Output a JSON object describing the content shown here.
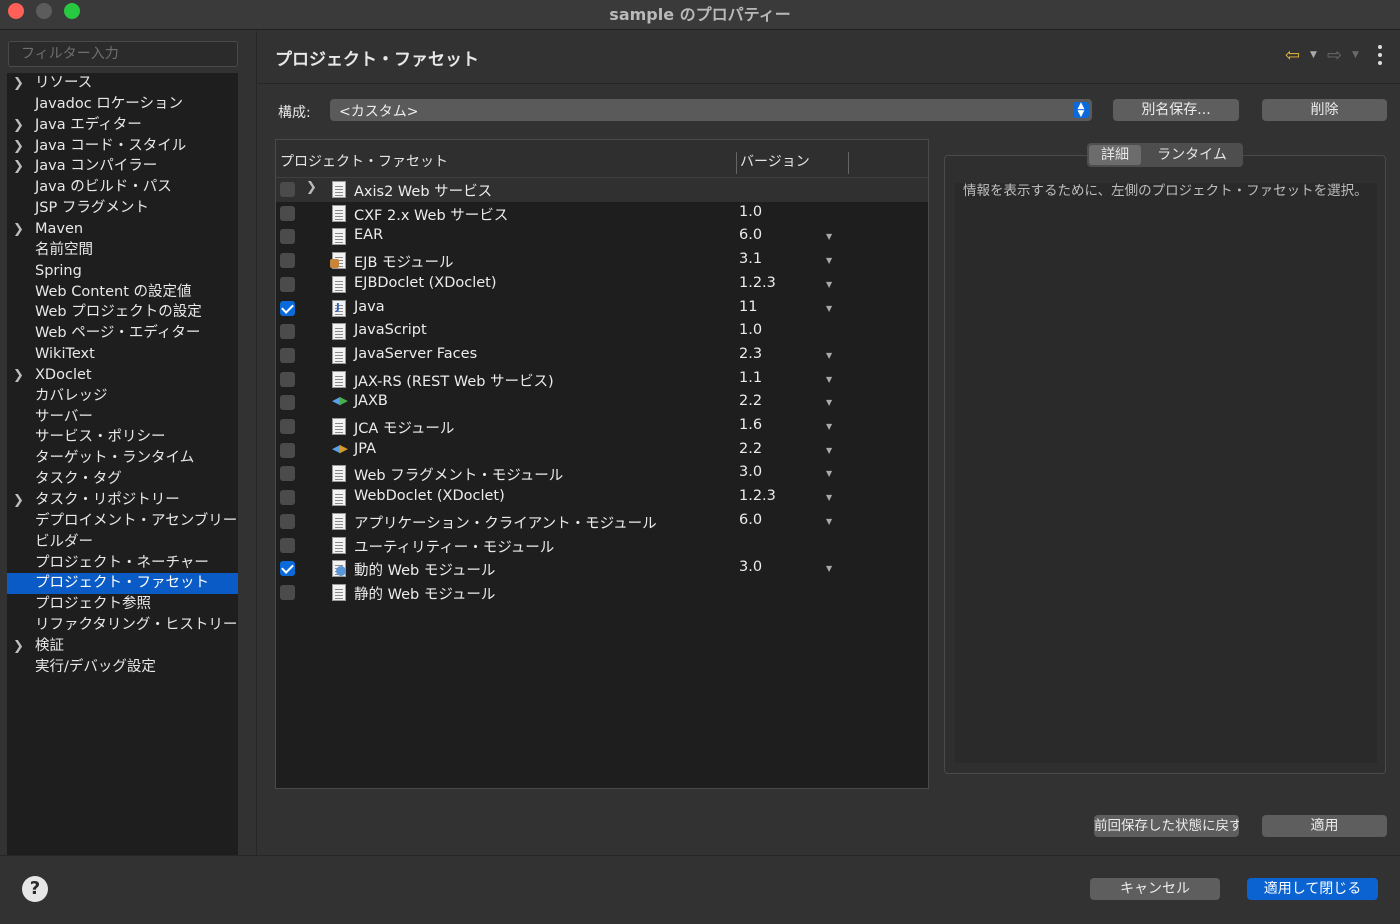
{
  "window": {
    "title": "sample のプロパティー"
  },
  "sidebar": {
    "filter_placeholder": "フィルター入力",
    "items": [
      {
        "label": "リソース",
        "expandable": true
      },
      {
        "label": "Javadoc ロケーション",
        "expandable": false
      },
      {
        "label": "Java エディター",
        "expandable": true
      },
      {
        "label": "Java コード・スタイル",
        "expandable": true
      },
      {
        "label": "Java コンパイラー",
        "expandable": true
      },
      {
        "label": "Java のビルド・パス",
        "expandable": false
      },
      {
        "label": "JSP フラグメント",
        "expandable": false
      },
      {
        "label": "Maven",
        "expandable": true
      },
      {
        "label": "名前空間",
        "expandable": false
      },
      {
        "label": "Spring",
        "expandable": false
      },
      {
        "label": "Web Content の設定値",
        "expandable": false
      },
      {
        "label": "Web プロジェクトの設定",
        "expandable": false
      },
      {
        "label": "Web ページ・エディター",
        "expandable": false
      },
      {
        "label": "WikiText",
        "expandable": false
      },
      {
        "label": "XDoclet",
        "expandable": true
      },
      {
        "label": "カバレッジ",
        "expandable": false
      },
      {
        "label": "サーバー",
        "expandable": false
      },
      {
        "label": "サービス・ポリシー",
        "expandable": false
      },
      {
        "label": "ターゲット・ランタイム",
        "expandable": false
      },
      {
        "label": "タスク・タグ",
        "expandable": false
      },
      {
        "label": "タスク・リポジトリー",
        "expandable": true
      },
      {
        "label": "デプロイメント・アセンブリー",
        "expandable": false
      },
      {
        "label": "ビルダー",
        "expandable": false
      },
      {
        "label": "プロジェクト・ネーチャー",
        "expandable": false
      },
      {
        "label": "プロジェクト・ファセット",
        "expandable": false,
        "selected": true
      },
      {
        "label": "プロジェクト参照",
        "expandable": false
      },
      {
        "label": "リファクタリング・ヒストリー",
        "expandable": false
      },
      {
        "label": "検証",
        "expandable": true
      },
      {
        "label": "実行/デバッグ設定",
        "expandable": false
      }
    ]
  },
  "main": {
    "title": "プロジェクト・ファセット",
    "config": {
      "label": "構成:",
      "value": "<カスタム>"
    },
    "buttons": {
      "save_as": "別名保存...",
      "delete": "削除",
      "revert": "前回保存した状態に戻す",
      "apply": "適用"
    },
    "table": {
      "col_facet": "プロジェクト・ファセット",
      "col_version": "バージョン",
      "rows": [
        {
          "name": "Axis2 Web サービス",
          "version": "",
          "checked": false,
          "icon": "doc",
          "expandable": true,
          "dropdown": false
        },
        {
          "name": "CXF 2.x Web サービス",
          "version": "1.0",
          "checked": false,
          "icon": "doc",
          "dropdown": false
        },
        {
          "name": "EAR",
          "version": "6.0",
          "checked": false,
          "icon": "doc",
          "dropdown": true
        },
        {
          "name": "EJB モジュール",
          "version": "3.1",
          "checked": false,
          "icon": "ejb",
          "dropdown": true
        },
        {
          "name": "EJBDoclet (XDoclet)",
          "version": "1.2.3",
          "checked": false,
          "icon": "doc",
          "dropdown": true
        },
        {
          "name": "Java",
          "version": "11",
          "checked": true,
          "icon": "java",
          "dropdown": true
        },
        {
          "name": "JavaScript",
          "version": "1.0",
          "checked": false,
          "icon": "doc",
          "dropdown": false
        },
        {
          "name": "JavaServer Faces",
          "version": "2.3",
          "checked": false,
          "icon": "doc",
          "dropdown": true
        },
        {
          "name": "JAX-RS (REST Web サービス)",
          "version": "1.1",
          "checked": false,
          "icon": "doc",
          "dropdown": true
        },
        {
          "name": "JAXB",
          "version": "2.2",
          "checked": false,
          "icon": "arrows",
          "dropdown": true
        },
        {
          "name": "JCA モジュール",
          "version": "1.6",
          "checked": false,
          "icon": "doc",
          "dropdown": true
        },
        {
          "name": "JPA",
          "version": "2.2",
          "checked": false,
          "icon": "jpa",
          "dropdown": true
        },
        {
          "name": "Web フラグメント・モジュール",
          "version": "3.0",
          "checked": false,
          "icon": "doc",
          "dropdown": true
        },
        {
          "name": "WebDoclet (XDoclet)",
          "version": "1.2.3",
          "checked": false,
          "icon": "doc",
          "dropdown": true
        },
        {
          "name": "アプリケーション・クライアント・モジュール",
          "version": "6.0",
          "checked": false,
          "icon": "doc",
          "dropdown": true
        },
        {
          "name": "ユーティリティー・モジュール",
          "version": "",
          "checked": false,
          "icon": "doc",
          "dropdown": false
        },
        {
          "name": "動的 Web モジュール",
          "version": "3.0",
          "checked": true,
          "icon": "web",
          "dropdown": true
        },
        {
          "name": "静的 Web モジュール",
          "version": "",
          "checked": false,
          "icon": "doc",
          "dropdown": false
        }
      ]
    },
    "details": {
      "tabs": [
        "詳細",
        "ランタイム"
      ],
      "active_tab": 0,
      "text": "情報を表示するために、左側のプロジェクト・ファセットを選択。"
    }
  },
  "footer": {
    "help": "?",
    "cancel": "キャンセル",
    "apply_close": "適用して閉じる"
  },
  "colors": {
    "accent": "#0a63d0",
    "selection": "#0a5bc6",
    "nav_back": "#e9b73a"
  }
}
